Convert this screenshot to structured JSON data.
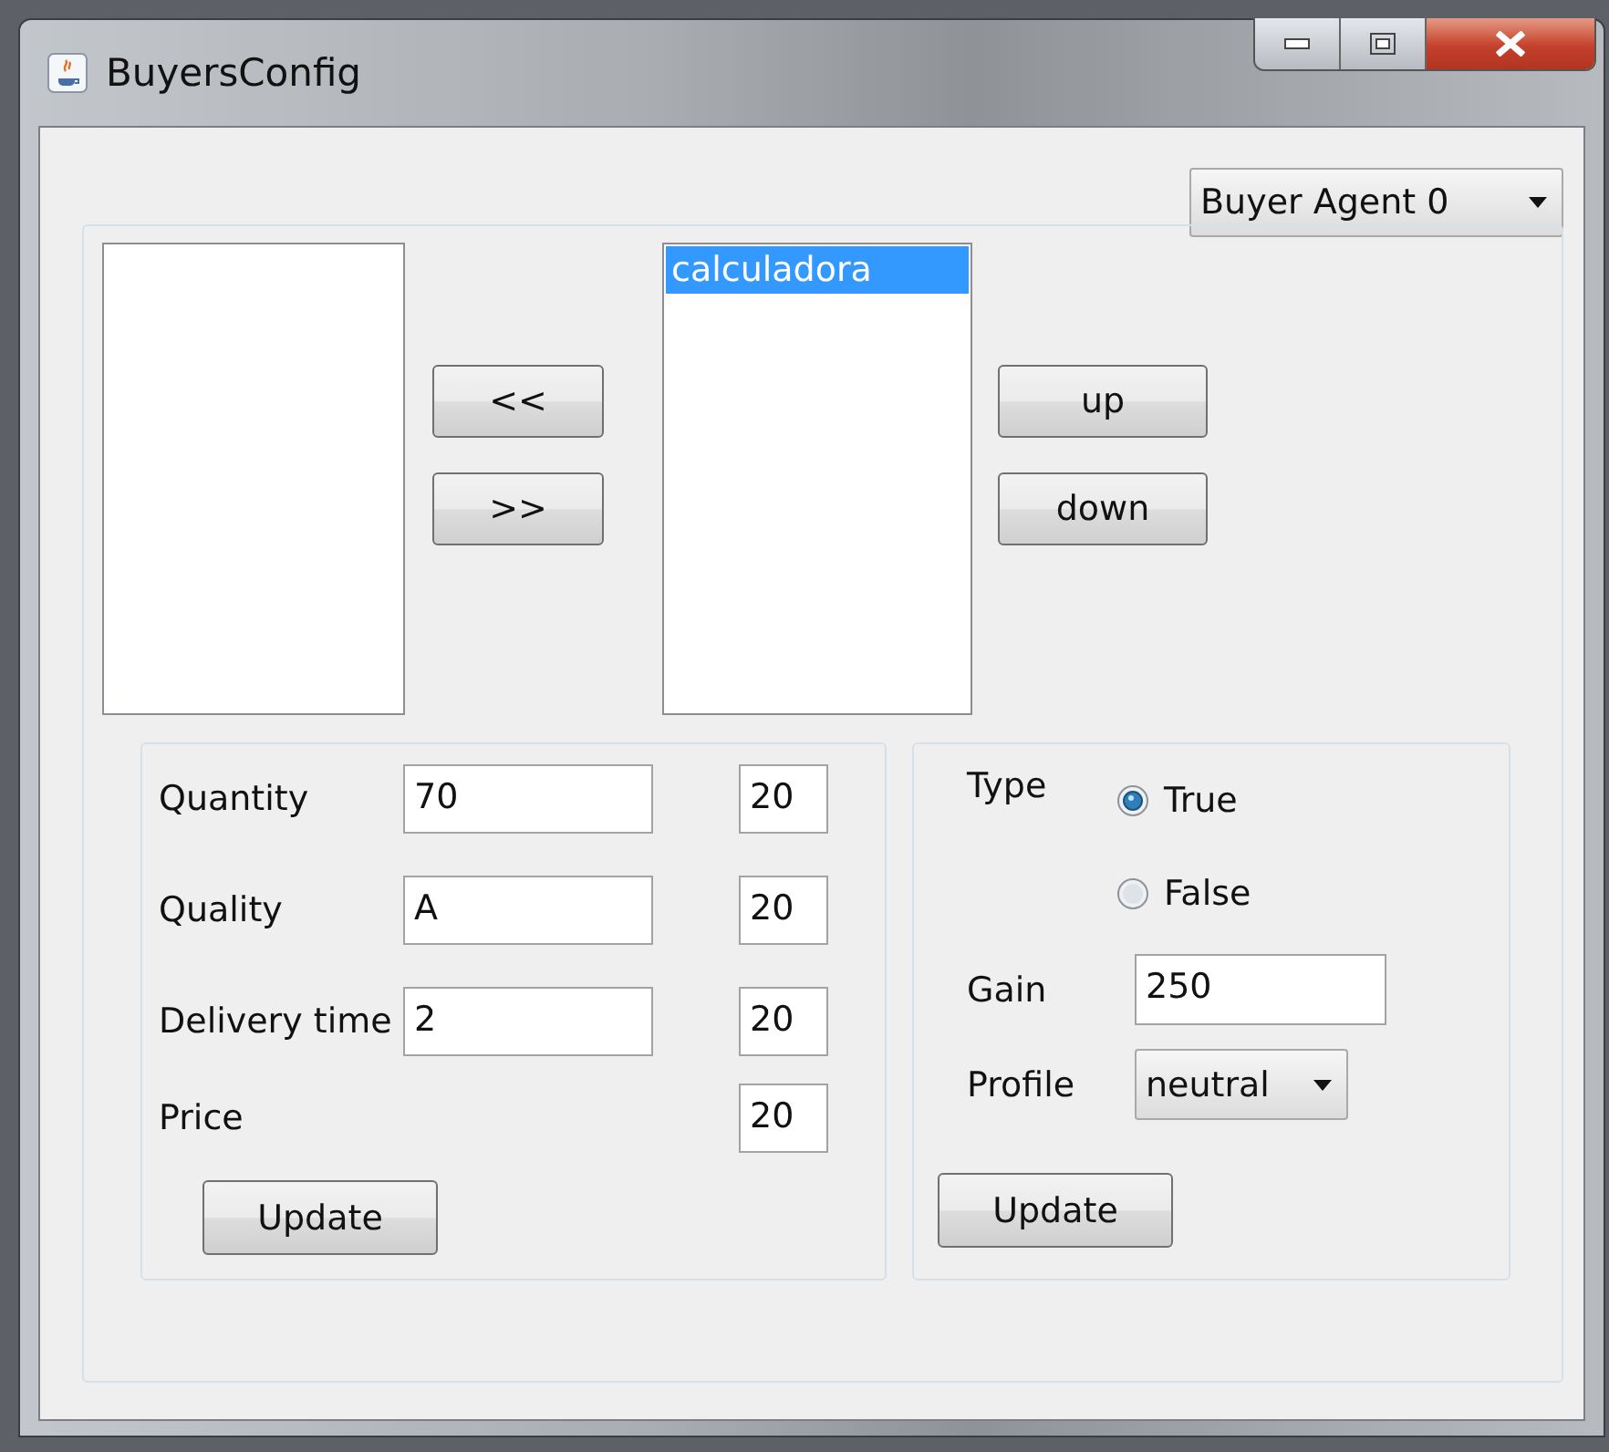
{
  "window": {
    "title": "BuyersConfig"
  },
  "agent_select": {
    "value": "Buyer Agent 0"
  },
  "selected_list": {
    "items": [
      {
        "label": "calculadora",
        "selected": true
      }
    ]
  },
  "move_buttons": [
    "<<",
    ">>"
  ],
  "order_buttons": [
    "up",
    "down"
  ],
  "criteria": {
    "rows": [
      {
        "label": "Quantity",
        "value": "70",
        "weight": "20"
      },
      {
        "label": "Quality",
        "value": "A",
        "weight": "20"
      },
      {
        "label": "Delivery time",
        "value": "2",
        "weight": "20"
      },
      {
        "label": "Price",
        "weight": "20"
      }
    ],
    "button": "Update"
  },
  "settings": {
    "type_label": "Type",
    "options": [
      {
        "label": "True",
        "selected": true
      },
      {
        "label": "False",
        "selected": false
      }
    ],
    "gain_label": "Gain",
    "gain": "250",
    "profile_label": "Profile",
    "profile": "neutral",
    "button": "Update"
  }
}
